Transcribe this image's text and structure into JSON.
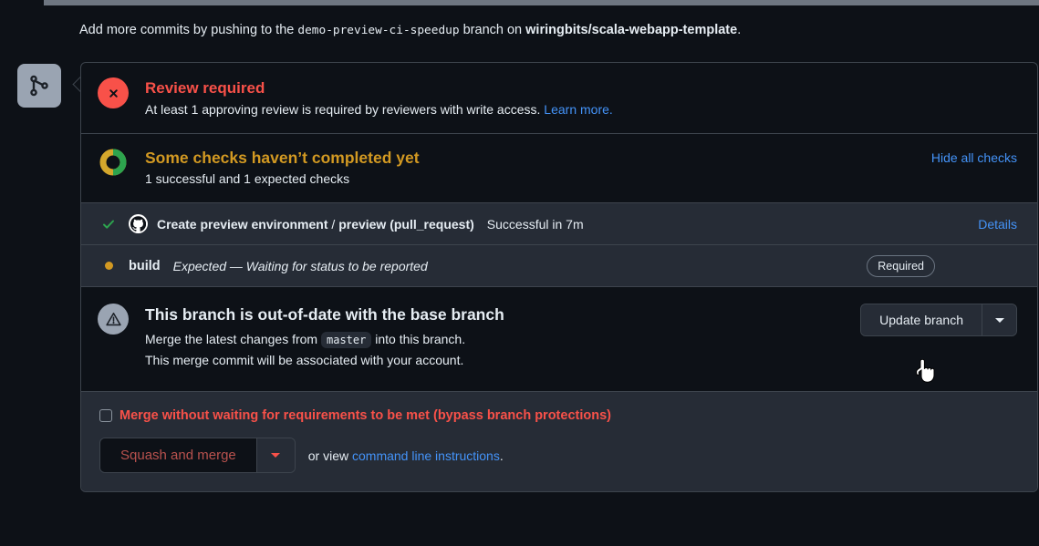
{
  "header": {
    "prefix": "Add more commits by pushing to the ",
    "branch": "demo-preview-ci-speedup",
    "middle": " branch on ",
    "repo": "wiringbits/scala-webapp-template",
    "suffix": "."
  },
  "review": {
    "title": "Review required",
    "description": "At least 1 approving review is required by reviewers with write access. ",
    "learn_more": "Learn more.",
    "icon": "x-circle-icon",
    "color": "#f85149"
  },
  "checks": {
    "title": "Some checks haven’t completed yet",
    "subtitle": "1 successful and 1 expected checks",
    "hide_all_label": "Hide all checks",
    "icon": "donut-progress-icon",
    "title_color": "#d29922",
    "rows": [
      {
        "status_icon": "check-icon",
        "avatar": "github-actions-icon",
        "name": "Create preview environment",
        "separator": " / ",
        "job": "preview (pull_request)",
        "description": "Successful in 7m",
        "italic": false,
        "action_label": "Details",
        "badge": null
      },
      {
        "status_icon": "amber-dot-icon",
        "avatar": null,
        "name": "build",
        "separator": "",
        "job": "",
        "description": "Expected — Waiting for status to be reported",
        "italic": true,
        "action_label": null,
        "badge": "Required"
      }
    ]
  },
  "outdated": {
    "title": "This branch is out-of-date with the base branch",
    "line1_prefix": "Merge the latest changes from ",
    "base_branch": "master",
    "line1_suffix": " into this branch.",
    "line2": "This merge commit will be associated with your account.",
    "icon": "alert-triangle-icon",
    "update_button": "Update branch",
    "update_caret": "chevron-down-icon"
  },
  "merge": {
    "bypass_label": "Merge without waiting for requirements to be met (bypass branch protections)",
    "bypass_checked": false,
    "bypass_color": "#f85149",
    "merge_button": "Squash and merge",
    "merge_caret": "chevron-down-icon",
    "or_view_prefix": "or view ",
    "cli_link": "command line instructions",
    "or_view_suffix": "."
  },
  "sidebar": {
    "timeline_icon": "git-merge-icon"
  }
}
